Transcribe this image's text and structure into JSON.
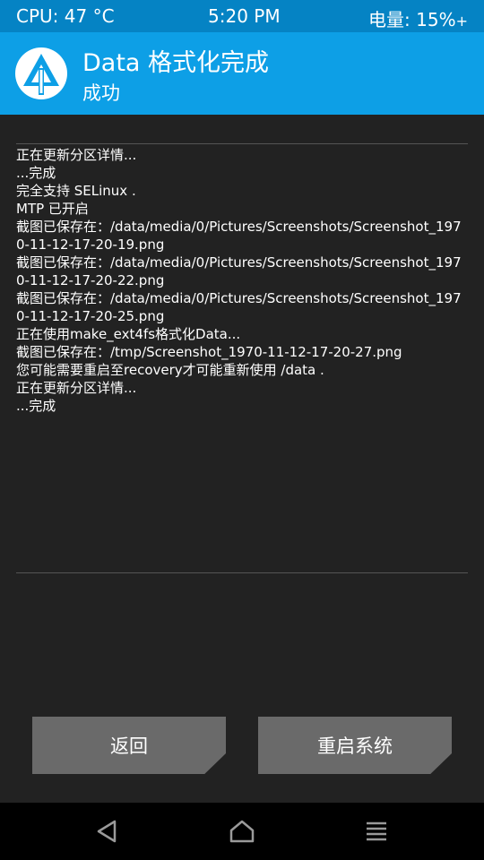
{
  "status_bar": {
    "cpu": "CPU: 47 °C",
    "time": "5:20 PM",
    "battery": "电量: 15%",
    "battery_charging": "+"
  },
  "header": {
    "logo_icon": "twrp-logo-icon",
    "title": "Data 格式化完成",
    "subtitle": "成功"
  },
  "console": {
    "lines": [
      "正在更新分区详情...",
      "...完成",
      "完全支持 SELinux .",
      "MTP 已开启",
      "截图已保存在：/data/media/0/Pictures/Screenshots/Screenshot_1970-11-12-17-20-19.png",
      "截图已保存在：/data/media/0/Pictures/Screenshots/Screenshot_1970-11-12-17-20-22.png",
      "截图已保存在：/data/media/0/Pictures/Screenshots/Screenshot_1970-11-12-17-20-25.png",
      "正在使用make_ext4fs格式化Data...",
      "截图已保存在：/tmp/Screenshot_1970-11-12-17-20-27.png",
      "您可能需要重启至recovery才可能重新使用 /data .",
      "正在更新分区详情...",
      "...完成"
    ]
  },
  "buttons": {
    "back": "返回",
    "reboot": "重启系统"
  },
  "nav": {
    "back_icon": "back-triangle-icon",
    "home_icon": "home-icon",
    "menu_icon": "menu-icon"
  },
  "colors": {
    "status_bar": "#0583c4",
    "header": "#0d9fe6",
    "background": "#222222",
    "button": "#6a6a6a",
    "nav_bar": "#000000"
  }
}
